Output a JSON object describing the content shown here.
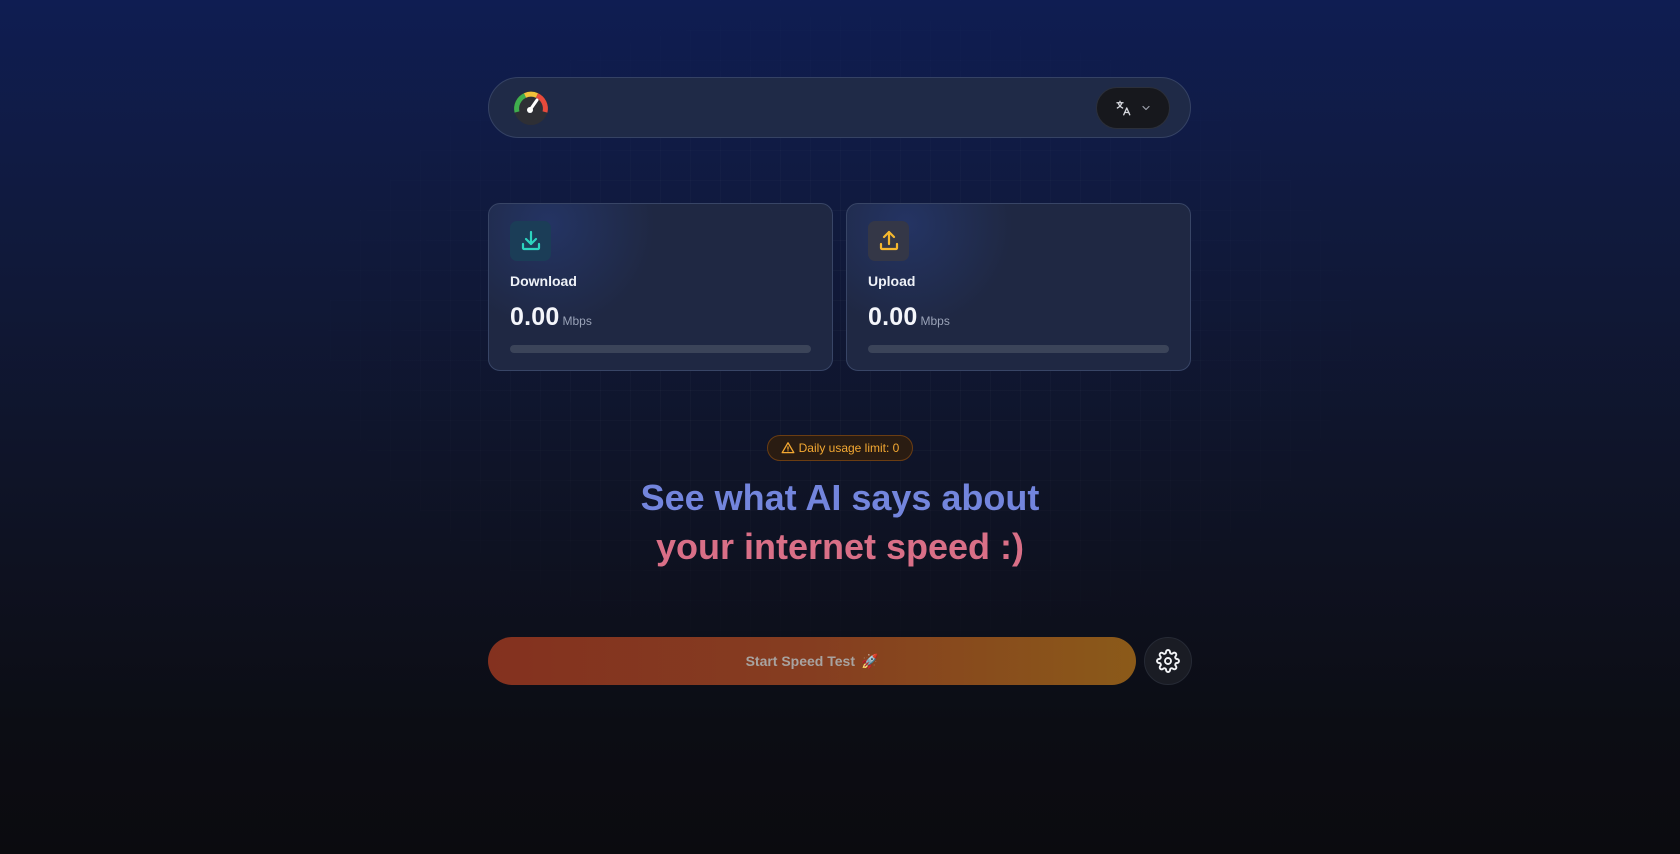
{
  "header": {
    "logo": "speedometer-icon",
    "language_button_icon": "translate-icon"
  },
  "cards": [
    {
      "label": "Download",
      "value": "0.00",
      "unit": "Mbps",
      "icon": "download-icon",
      "progress": 0,
      "accent": "#2dd4bf"
    },
    {
      "label": "Upload",
      "value": "0.00",
      "unit": "Mbps",
      "icon": "upload-icon",
      "progress": 0,
      "accent": "#f5b82e"
    }
  ],
  "usage_badge": {
    "text": "Daily usage limit: 0",
    "icon": "warning-icon",
    "color": "#f4a832"
  },
  "headline": {
    "line1": "See what AI says about",
    "line2": "your internet speed :)"
  },
  "start_button": {
    "label": "Start Speed Test",
    "emoji": "🚀"
  },
  "settings_button": {
    "icon": "gear-icon"
  }
}
